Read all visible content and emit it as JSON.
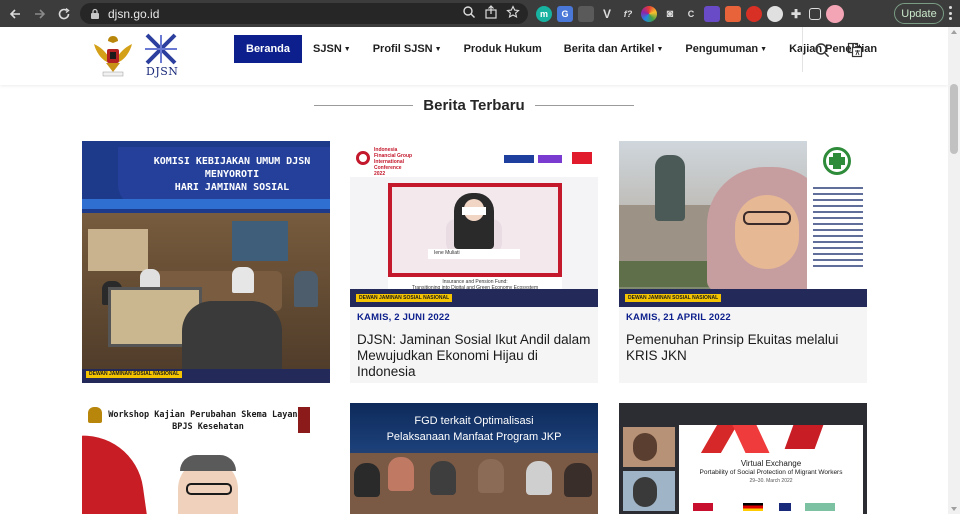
{
  "browser": {
    "url": "djsn.go.id",
    "update_label": "Update",
    "colors": {
      "frame": "#3c3c3c",
      "omnibox": "#262626"
    }
  },
  "site": {
    "logo_text": "DJSN",
    "menu": [
      {
        "label": "Beranda",
        "has_caret": false,
        "active": true
      },
      {
        "label": "SJSN",
        "has_caret": true
      },
      {
        "label": "Profil SJSN",
        "has_caret": true
      },
      {
        "label": "Produk Hukum",
        "has_caret": false
      },
      {
        "label": "Berita dan Artikel",
        "has_caret": true
      },
      {
        "label": "Pengumuman",
        "has_caret": true
      },
      {
        "label": "Kajian Penelitian",
        "has_caret": false
      }
    ],
    "colors": {
      "nav_active": "#0c1f8c",
      "date": "#0c1f8c"
    }
  },
  "news": {
    "section_title": "Berita Terbaru",
    "cards": [
      {
        "banner": "KOMISI KEBIJAKAN UMUM DJSN MENYOROTI HARI JAMINAN SOSIAL",
        "banner_lines": [
          "KOMISI KEBIJAKAN UMUM DJSN",
          "MENYOROTI",
          "HARI JAMINAN SOSIAL"
        ],
        "footer_label": "DEWAN JAMINAN SOSIAL NASIONAL",
        "date": "",
        "title": ""
      },
      {
        "banner_lines": [
          "Indonesia",
          "Financial Group",
          "International",
          "Conference",
          "2022"
        ],
        "caption_name": "Iene Muliati",
        "caption_sub": "Insurance and Pension Fund:",
        "caption_sub2": "Transitioning into Digital and Green Economy Ecosystem",
        "footer_label": "DEWAN JAMINAN SOSIAL NASIONAL",
        "date": "KAMIS, 2 JUNI 2022",
        "title": "DJSN: Jaminan Sosial Ikut Andil dalam Mewujudkan Ekonomi Hijau di Indonesia"
      },
      {
        "footer_label": "DEWAN JAMINAN SOSIAL NASIONAL",
        "date": "KAMIS, 21 APRIL 2022",
        "title": "Pemenuhan Prinsip Ekuitas melalui KRIS JKN"
      },
      {
        "banner_lines": [
          "Workshop Kajian Perubahan Skema Layanan",
          "BPJS Kesehatan"
        ],
        "date": "",
        "title": ""
      },
      {
        "banner_lines": [
          "FGD terkait Optimalisasi",
          "Pelaksanaan Manfaat Program JKP"
        ],
        "date": "",
        "title": ""
      },
      {
        "banner_lines": [
          "Virtual Exchange",
          "Portability of Social Protection of Migrant Workers",
          "29–30. March 2022"
        ],
        "date": "",
        "title": ""
      }
    ]
  }
}
